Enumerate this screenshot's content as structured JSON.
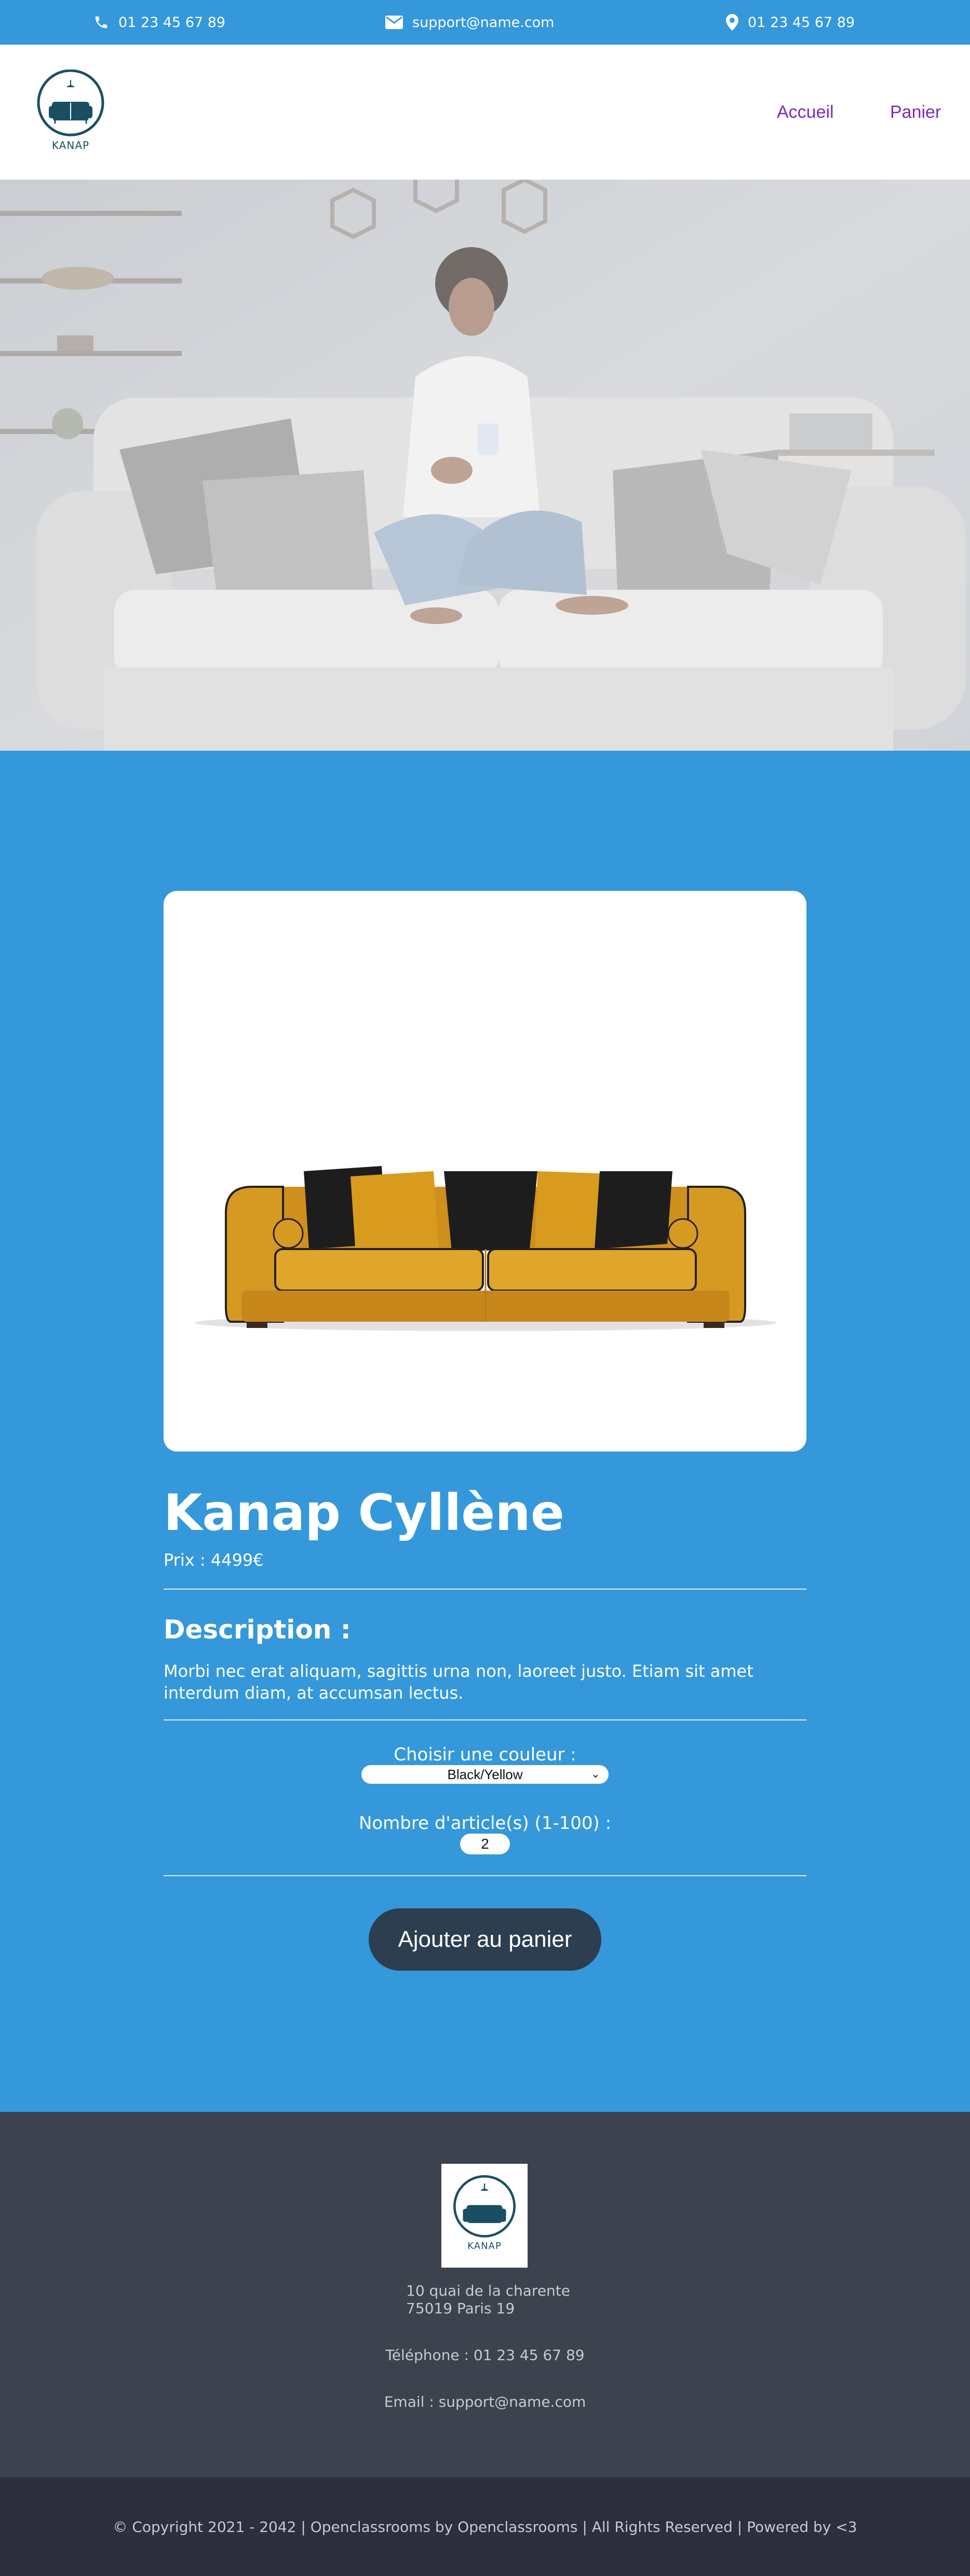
{
  "topbar": {
    "phone": "01 23 45 67 89",
    "email": "support@name.com",
    "location_phone": "01 23 45 67 89",
    "icons": [
      "phone-icon",
      "mail-icon",
      "location-pin-icon"
    ]
  },
  "header": {
    "logo_text": "KANAP",
    "nav": {
      "home": "Accueil",
      "cart": "Panier"
    }
  },
  "product": {
    "title": "Kanap Cyllène",
    "price_label": "Prix : 4499€",
    "description_title": "Description :",
    "description_text": "Morbi nec erat aliquam, sagittis urna non, laoreet justo. Etiam sit amet interdum diam, at accumsan lectus.",
    "color_label": "Choisir une couleur :",
    "color_selected": "Black/Yellow",
    "quantity_label": "Nombre d'article(s) (1-100) :",
    "quantity_value": "2",
    "add_button": "Ajouter au panier"
  },
  "footer": {
    "logo_text": "KANAP",
    "address_line1": "10 quai de la charente",
    "address_line2": "75019 Paris 19",
    "telephone": "Téléphone : 01 23 45 67 89",
    "email": "Email : support@name.com",
    "copyright": "© Copyright 2021 - 2042 | Openclassrooms by Openclassrooms | All Rights Reserved | Powered by <3"
  },
  "colors": {
    "primary_blue": "#3498db",
    "header_bg": "#ffffff",
    "nav_link": "#7a2abf",
    "button_dark": "#2c3e50",
    "footer_bg": "#3d424f",
    "bottom_bg": "#2d2f3e",
    "sofa_yellow": "#d69a23"
  }
}
